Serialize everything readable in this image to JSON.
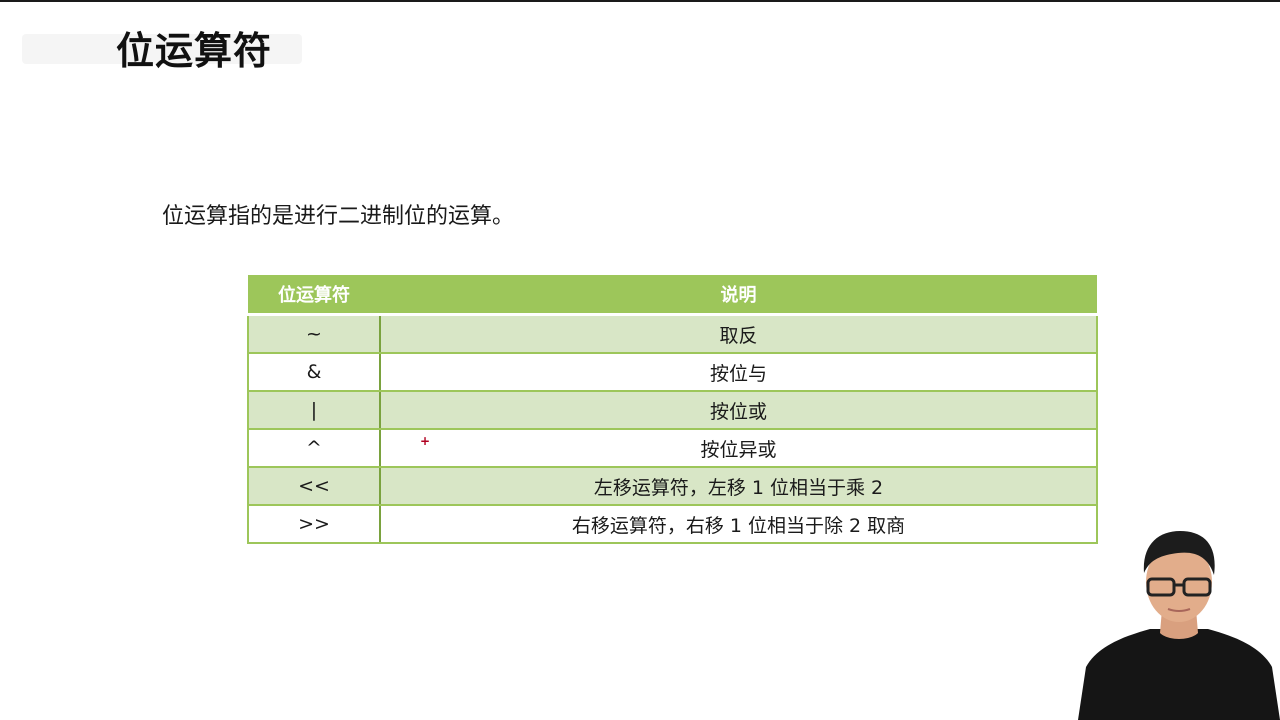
{
  "slide": {
    "title": "位运算符",
    "intro": "位运算指的是进行二进制位的运算。"
  },
  "table": {
    "headers": [
      "位运算符",
      "说明"
    ],
    "rows": [
      {
        "op": "~",
        "desc": "取反"
      },
      {
        "op": "&",
        "desc": "按位与"
      },
      {
        "op": "|",
        "desc": "按位或"
      },
      {
        "op": "^",
        "desc": "按位异或"
      },
      {
        "op": "<<",
        "desc": "左移运算符，左移 1 位相当于乘 2"
      },
      {
        "op": ">>",
        "desc": "右移运算符，右移 1 位相当于除 2 取商"
      }
    ]
  },
  "colors": {
    "header_green": "#9dc65a",
    "row_shade": "#d8e6c6",
    "border_green": "#9dc65a"
  },
  "icons": {
    "cursor": "plus-cursor-icon"
  }
}
